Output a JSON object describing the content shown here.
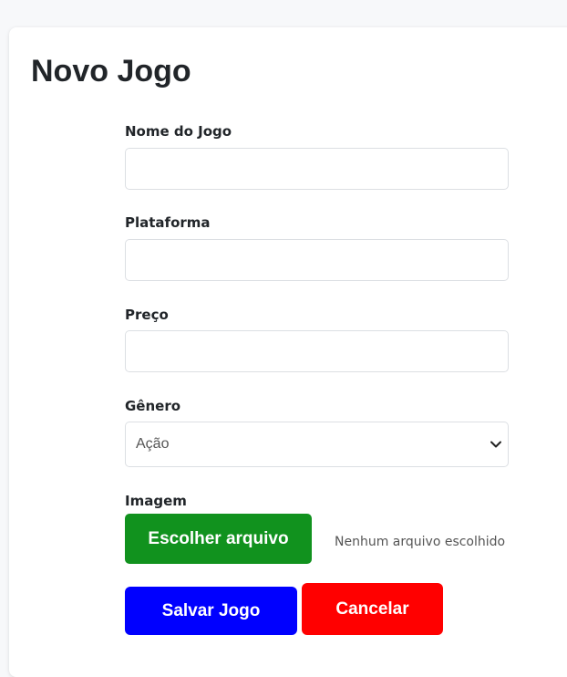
{
  "page": {
    "title": "Novo Jogo"
  },
  "form": {
    "name": {
      "label": "Nome do Jogo",
      "value": "",
      "placeholder": ""
    },
    "platform": {
      "label": "Plataforma",
      "value": "",
      "placeholder": ""
    },
    "price": {
      "label": "Preço",
      "value": "",
      "placeholder": ""
    },
    "genre": {
      "label": "Gênero",
      "selected": "Ação",
      "icon": "chevron-down-icon"
    },
    "image": {
      "label": "Imagem",
      "button_label": "Escolher arquivo",
      "status": "Nenhum arquivo escolhido"
    }
  },
  "actions": {
    "save_label": "Salvar Jogo",
    "cancel_label": "Cancelar"
  },
  "colors": {
    "file_button": "#11921e",
    "save_button": "#0000ff",
    "cancel_button": "#ff0000",
    "card_background": "#ffffff",
    "page_background": "#f7f8fa"
  }
}
